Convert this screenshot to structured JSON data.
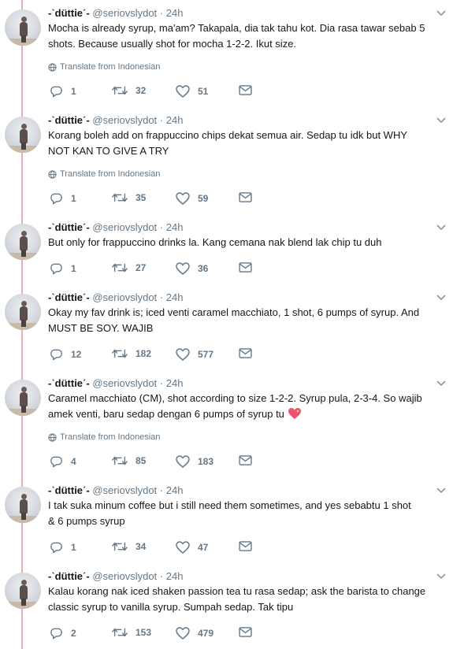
{
  "translate_label": "Translate from Indonesian",
  "tweets": [
    {
      "display_name": "-ˋdüttieˊ-",
      "handle": "@seriovslydot",
      "time": "· 24h",
      "lines": [
        "Mocha is already syrup, ma'am? Takapala, dia tak tahu kot. Dia rasa tawar sebab 5",
        "shots. Because usually shot for mocha 1-2-2. Ikut size."
      ],
      "has_translate": true,
      "replies": "1",
      "retweets": "32",
      "likes": "51"
    },
    {
      "display_name": "-ˋdüttieˊ-",
      "handle": "@seriovslydot",
      "time": "· 24h",
      "lines": [
        "Korang boleh add on frappuccino chips dekat semua air. Sedap tu idk but WHY",
        "NOT KAN TO GIVE A TRY"
      ],
      "has_translate": true,
      "replies": "1",
      "retweets": "35",
      "likes": "59"
    },
    {
      "display_name": "-ˋdüttieˊ-",
      "handle": "@seriovslydot",
      "time": "· 24h",
      "lines": [
        "But only for frappuccino drinks la. Kang cemana nak blend lak chip tu duh"
      ],
      "has_translate": false,
      "replies": "1",
      "retweets": "27",
      "likes": "36"
    },
    {
      "display_name": "-ˋdüttieˊ-",
      "handle": "@seriovslydot",
      "time": "· 24h",
      "lines": [
        "Okay my fav drink is; iced venti caramel macchiato, 1 shot, 6 pumps of syrup. And",
        "MUST BE SOY. WAJIB"
      ],
      "has_translate": false,
      "replies": "12",
      "retweets": "182",
      "likes": "577"
    },
    {
      "display_name": "-ˋdüttieˊ-",
      "handle": "@seriovslydot",
      "time": "· 24h",
      "lines": [
        "Caramel macchiato (CM), shot according to size 1-2-2. Syrup pula, 2-3-4. So wajib",
        "amek venti, baru sedap dengan 6 pumps of syrup tu"
      ],
      "has_emoji": true,
      "has_translate": true,
      "replies": "4",
      "retweets": "85",
      "likes": "183"
    },
    {
      "display_name": "-ˋdüttieˊ-",
      "handle": "@seriovslydot",
      "time": "· 24h",
      "lines": [
        "I tak suka minum coffee but i still need them sometimes, and yes sebabtu 1 shot",
        "& 6 pumps syrup"
      ],
      "has_translate": false,
      "replies": "1",
      "retweets": "34",
      "likes": "47"
    },
    {
      "display_name": "-ˋdüttieˊ-",
      "handle": "@seriovslydot",
      "time": "· 24h",
      "lines": [
        "Kalau korang nak iced shaken passion tea tu rasa sedap; ask the barista to change",
        "classic syrup to vanilla syrup. Sumpah sedap. Tak tipu"
      ],
      "has_translate": false,
      "replies": "2",
      "retweets": "153",
      "likes": "479"
    }
  ]
}
